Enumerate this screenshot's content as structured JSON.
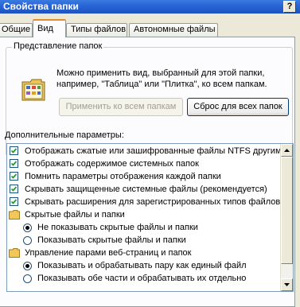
{
  "window": {
    "title": "Свойства папки",
    "help_label": "?"
  },
  "tabs": [
    {
      "label": "Общие",
      "active": false
    },
    {
      "label": "Вид",
      "active": true
    },
    {
      "label": "Типы файлов",
      "active": false
    },
    {
      "label": "Автономные файлы",
      "active": false
    }
  ],
  "folder_views": {
    "legend": "Представление папок",
    "description": "Можно применить вид, выбранный для этой папки, например, \"Таблица\" или \"Плитка\", ко всем папкам.",
    "apply_label": "Применить ко всем папкам",
    "reset_label": "Сброс для всех папок"
  },
  "advanced": {
    "label": "Дополнительные параметры:",
    "items": [
      {
        "type": "checkbox",
        "checked": true,
        "label": "Отображать сжатые или зашифрованные файлы NTFS другим цветом"
      },
      {
        "type": "checkbox",
        "checked": true,
        "label": "Отображать содержимое системных папок"
      },
      {
        "type": "checkbox",
        "checked": true,
        "label": "Помнить параметры отображения каждой папки"
      },
      {
        "type": "checkbox",
        "checked": true,
        "label": "Скрывать защищенные системные файлы (рекомендуется)"
      },
      {
        "type": "checkbox",
        "checked": true,
        "label": "Скрывать расширения для зарегистрированных типов файлов"
      },
      {
        "type": "folder",
        "label": "Скрытые файлы и папки"
      },
      {
        "type": "radio",
        "checked": true,
        "label": "Не показывать скрытые файлы и папки"
      },
      {
        "type": "radio",
        "checked": false,
        "label": "Показывать скрытые файлы и папки"
      },
      {
        "type": "folder",
        "label": "Управление парами веб-страниц и папок"
      },
      {
        "type": "radio",
        "checked": true,
        "label": "Показывать и обрабатывать пару как единый файл"
      },
      {
        "type": "radio",
        "checked": false,
        "label": "Показывать обе части и обрабатывать их отдельно"
      }
    ]
  },
  "colors": {
    "titlebar": "#2863d6",
    "active_tab_accent": "#e68b2c",
    "panel_bg": "#fcfcfe",
    "dialog_bg": "#ece9d8"
  }
}
